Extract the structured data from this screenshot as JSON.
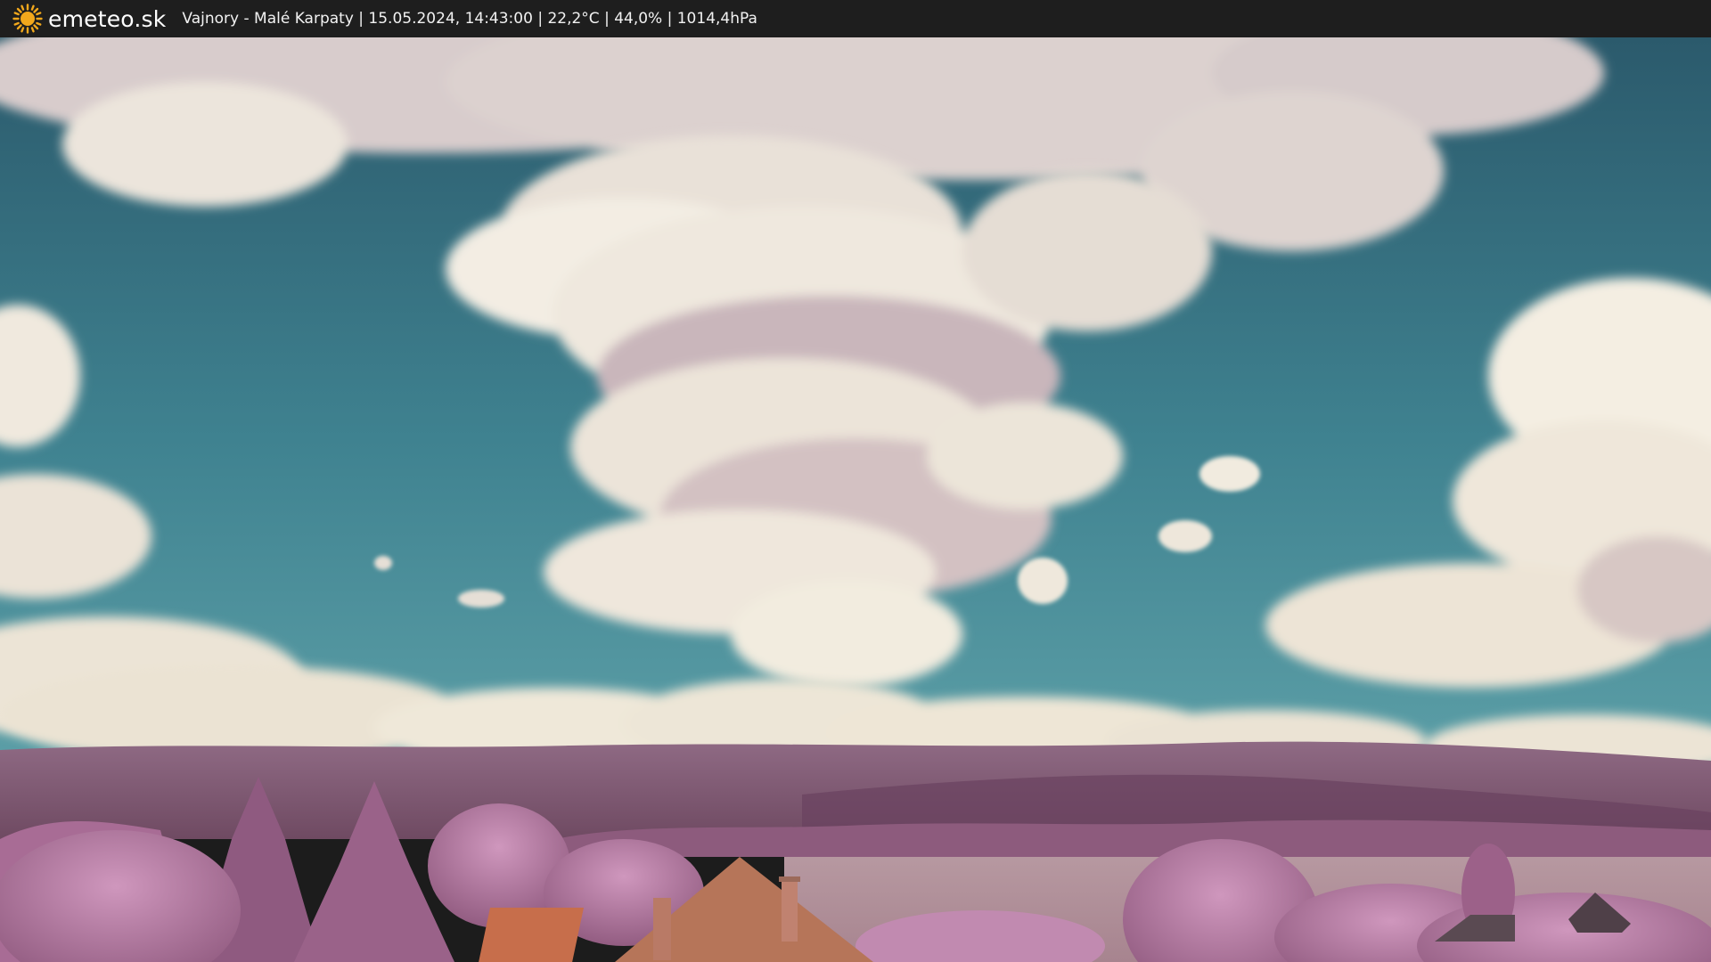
{
  "header": {
    "brand": "emeteo.sk",
    "caption": "Vajnory - Malé Karpaty | 15.05.2024, 14:43:00 | 22,2°C | 44,0% | 1014,4hPa",
    "icon": "sun-icon"
  },
  "colors": {
    "bar": "#1e1e1e",
    "sun": "#f2a81c",
    "sky_top": "#2e5f70",
    "sky_bottom": "#4f95a1",
    "cloud": "#f3efe6",
    "cloud_shadow": "#b8a7ae",
    "hills": "#8a5a78",
    "foliage": "#b57aa4",
    "roof": "#c9724f",
    "field": "#b99aa3"
  }
}
